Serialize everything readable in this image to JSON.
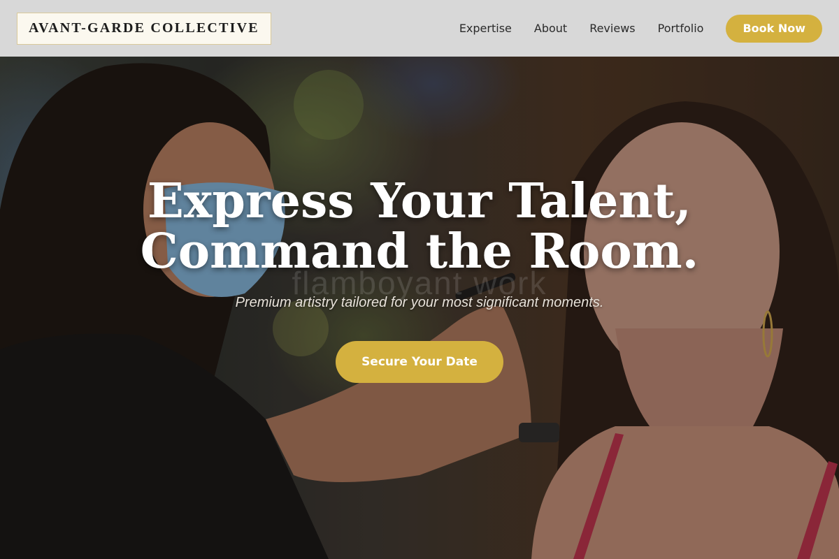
{
  "brand": {
    "name": "AVANT-GARDE COLLECTIVE"
  },
  "nav": {
    "items": [
      {
        "label": "Expertise"
      },
      {
        "label": "About"
      },
      {
        "label": "Reviews"
      },
      {
        "label": "Portfolio"
      }
    ],
    "cta_label": "Book Now"
  },
  "hero": {
    "headline_line1": "Express Your Talent,",
    "headline_line2": "Command the Room.",
    "watermark_text": "flamboyant work",
    "subtitle": "Premium artistry tailored for your most significant moments.",
    "cta_label": "Secure Your Date"
  },
  "colors": {
    "accent": "#d4b13f",
    "header_bg": "#d8d8d8",
    "logo_bg": "#fbf8ef",
    "hero_text": "#ffffff"
  }
}
